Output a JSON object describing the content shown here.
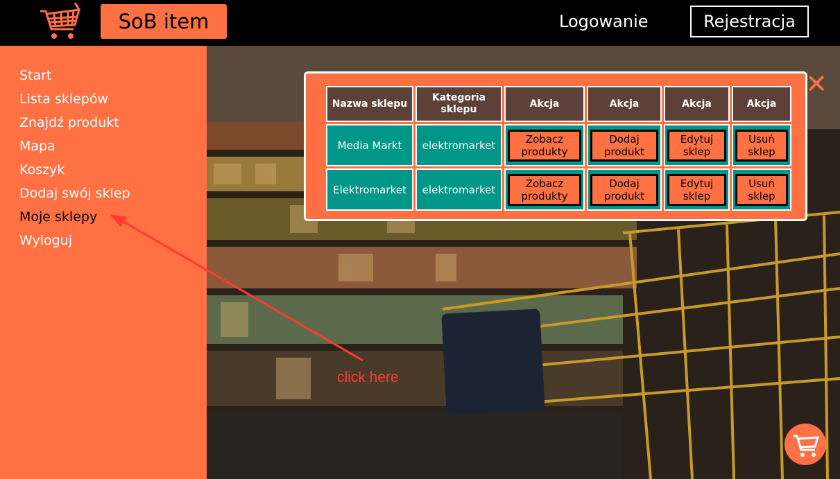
{
  "header": {
    "brand": "SoB item",
    "login": "Logowanie",
    "register": "Rejestracja",
    "logo_icon": "shopping-cart-icon"
  },
  "sidebar": {
    "items": [
      {
        "label": "Start",
        "active": false
      },
      {
        "label": "Lista sklepów",
        "active": false
      },
      {
        "label": "Znajdź produkt",
        "active": false
      },
      {
        "label": "Mapa",
        "active": false
      },
      {
        "label": "Koszyk",
        "active": false
      },
      {
        "label": "Dodaj swój sklep",
        "active": false
      },
      {
        "label": "Moje sklepy",
        "active": true
      },
      {
        "label": "Wyloguj",
        "active": false
      }
    ]
  },
  "modal": {
    "close_icon": "close-icon",
    "headers": [
      "Nazwa sklepu",
      "Kategoria sklepu",
      "Akcja",
      "Akcja",
      "Akcja",
      "Akcja"
    ],
    "rows": [
      {
        "name": "Media Markt",
        "category": "elektromarket",
        "actions": [
          "Zobacz produkty",
          "Dodaj produkt",
          "Edytuj sklep",
          "Usuń sklep"
        ]
      },
      {
        "name": "Elektromarket",
        "category": "elektromarket",
        "actions": [
          "Zobacz produkty",
          "Dodaj produkt",
          "Edytuj sklep",
          "Usuń sklep"
        ]
      }
    ]
  },
  "annotation": {
    "text": "click here"
  },
  "fab": {
    "icon": "cart-icon"
  },
  "colors": {
    "accent": "#ff7043",
    "header_cell": "#5d4037",
    "data_cell": "#009688",
    "annotation": "#ff3b30"
  }
}
